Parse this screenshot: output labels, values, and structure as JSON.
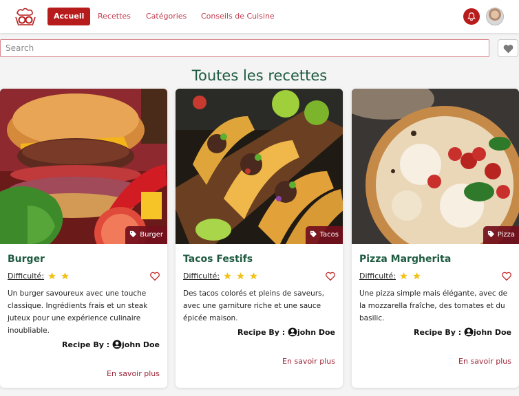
{
  "nav": {
    "items": [
      {
        "label": "Accueil"
      },
      {
        "label": "Recettes"
      },
      {
        "label": "Catégories"
      },
      {
        "label": "Conseils de Cuisine"
      }
    ]
  },
  "search": {
    "placeholder": "Search"
  },
  "page_title": "Toutes les recettes",
  "cards": [
    {
      "tag": "Burger",
      "title": "Burger",
      "difficulty_label": "Difficulté:",
      "stars": 2,
      "description": "Un burger savoureux avec une touche classique. Ingrédients frais et un steak juteux pour une expérience culinaire inoubliable.",
      "recipe_by": "Recipe By :",
      "author": "john Doe",
      "more_label": "En savoir plus"
    },
    {
      "tag": "Tacos",
      "title": "Tacos Festifs",
      "difficulty_label": "Difficulté:",
      "stars": 3,
      "description": "Des tacos colorés et pleins de saveurs, avec une garniture riche et une sauce épicée maison.",
      "recipe_by": "Recipe By :",
      "author": "john Doe",
      "more_label": "En savoir plus"
    },
    {
      "tag": "Pizza",
      "title": "Pizza Margherita",
      "difficulty_label": "Difficulté:",
      "stars": 2,
      "description": "Une pizza simple mais élégante, avec de la mozzarella fraîche, des tomates et du basilic.",
      "recipe_by": "Recipe By :",
      "author": "john Doe",
      "more_label": "En savoir plus"
    }
  ],
  "colors": {
    "brand_red": "#b71c1c",
    "title_green": "#1e5b40",
    "star_yellow": "#f2c21b"
  }
}
